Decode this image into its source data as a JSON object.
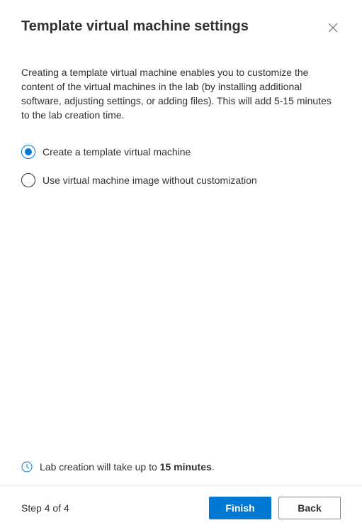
{
  "header": {
    "title": "Template virtual machine settings"
  },
  "description": "Creating a template virtual machine enables you to customize the content of the virtual machines in the lab (by installing additional software, adjusting settings, or adding files). This will add 5-15 minutes to the lab creation time.",
  "options": [
    {
      "label": "Create a template virtual machine",
      "selected": true
    },
    {
      "label": "Use virtual machine image without customization",
      "selected": false
    }
  ],
  "info": {
    "prefix": "Lab creation will take up to ",
    "bold": "15 minutes",
    "suffix": "."
  },
  "footer": {
    "step_label": "Step 4 of 4",
    "finish_label": "Finish",
    "back_label": "Back"
  }
}
